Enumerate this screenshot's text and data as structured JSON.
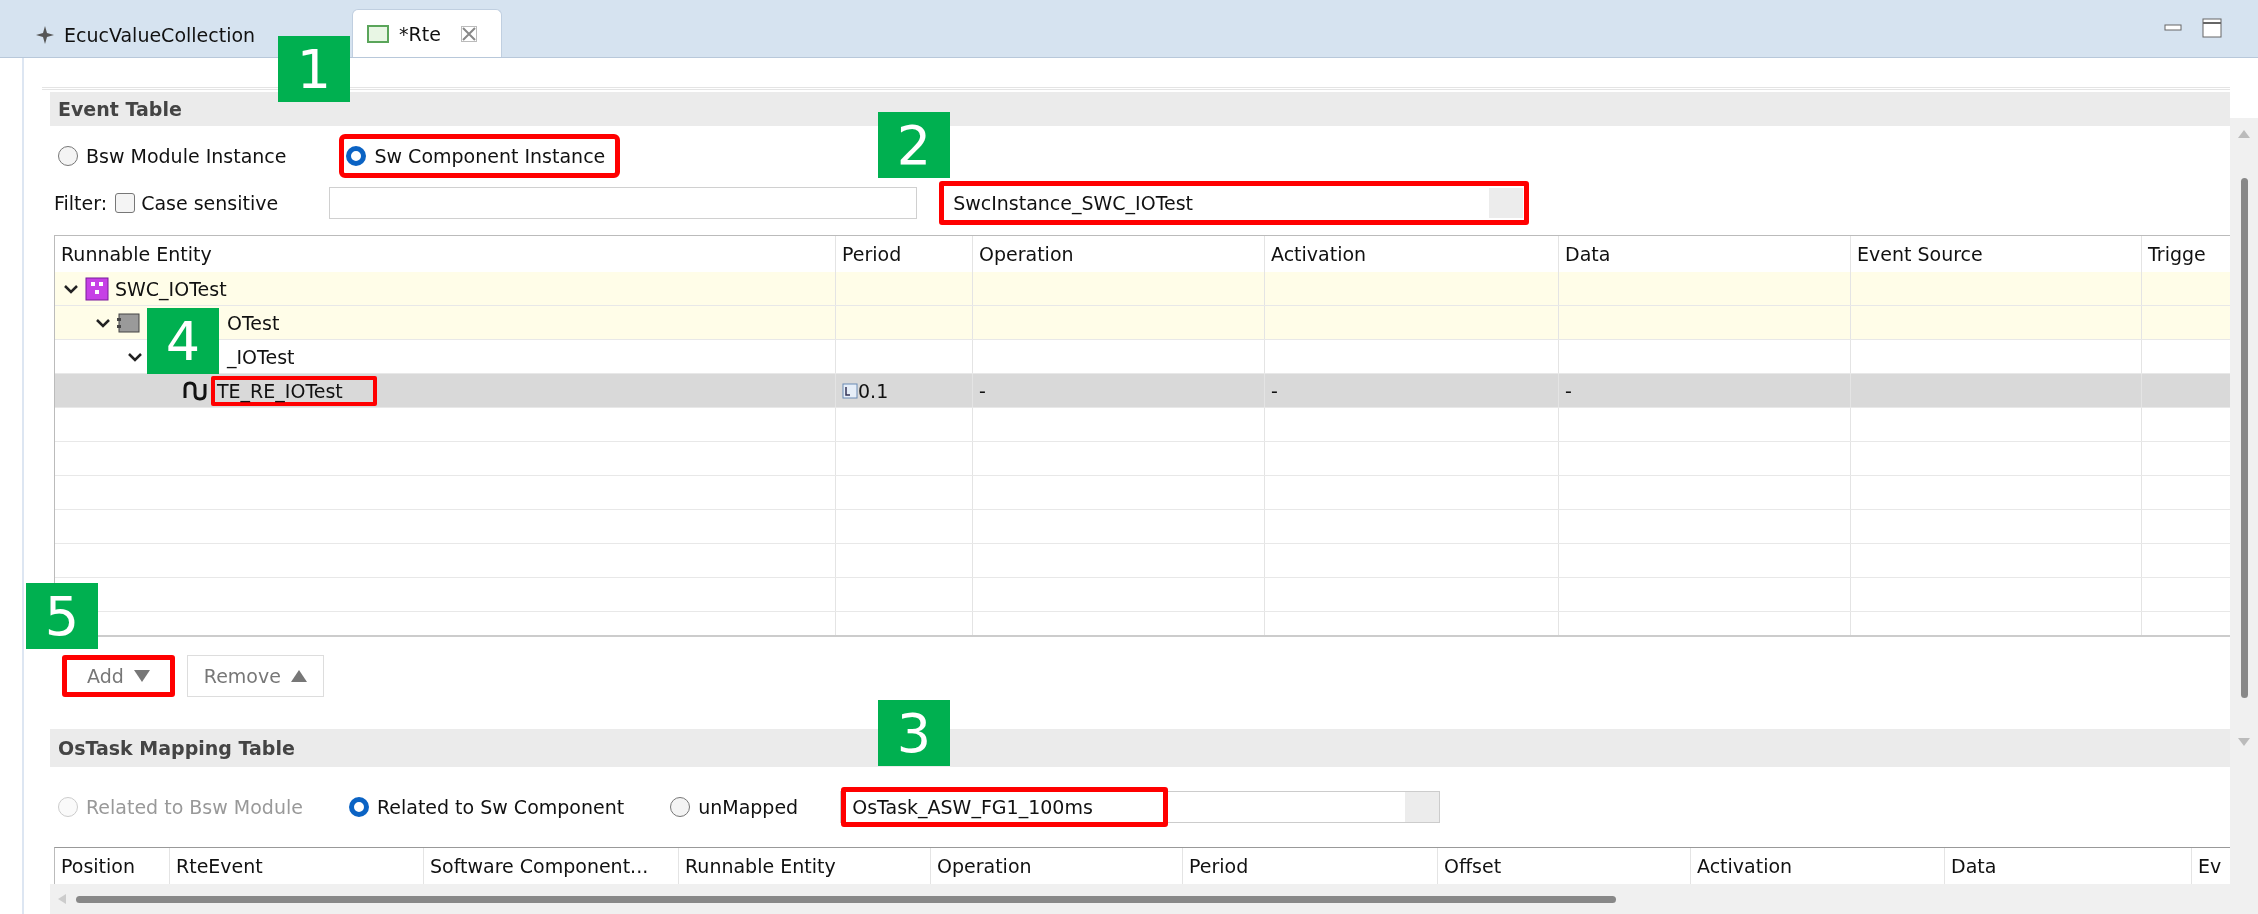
{
  "tabs": [
    {
      "label": "EcucValueCollection",
      "selected": false
    },
    {
      "label": "*Rte",
      "selected": true
    }
  ],
  "event_table": {
    "title": "Event Table",
    "modes": [
      {
        "label": "Bsw Module Instance",
        "selected": false,
        "disabled": false,
        "highlighted": false
      },
      {
        "label": "Sw Component Instance",
        "selected": true,
        "disabled": false,
        "highlighted": true
      }
    ],
    "filter": {
      "label": "Filter:",
      "case_sensitive": {
        "label": "Case sensitive",
        "checked": false
      }
    },
    "instance": {
      "value": "SwcInstance_SWC_IOTest",
      "highlighted": true
    },
    "columns": [
      "Runnable Entity",
      "Period",
      "Operation",
      "Activation",
      "Data",
      "Event Source",
      "Trigge"
    ],
    "rows": [
      {
        "kind": "swc",
        "label": "SWC_IOTest",
        "expanded": true,
        "selected": false,
        "highlighted": false,
        "children": [
          {
            "kind": "prototype",
            "label": "OTest",
            "expanded": true,
            "selected": false,
            "highlighted": false,
            "children": [
              {
                "kind": "behavior",
                "label": "_IOTest",
                "expanded": true,
                "selected": false,
                "highlighted": false,
                "children": [
                  {
                    "kind": "event",
                    "label": "TE_RE_IOTest",
                    "period": "0.1",
                    "operation": "-",
                    "activation": "-",
                    "data": "-",
                    "selected": true,
                    "highlighted": true
                  }
                ]
              }
            ]
          }
        ]
      }
    ]
  },
  "buttons": [
    {
      "label": "Add",
      "highlighted": true
    },
    {
      "label": "Remove",
      "highlighted": false
    }
  ],
  "mapping_table": {
    "title": "OsTask Mapping Table",
    "modes": [
      {
        "label": "Related to Bsw Module",
        "selected": false,
        "disabled": true,
        "highlighted": false
      },
      {
        "label": "Related to Sw Component",
        "selected": true,
        "disabled": false,
        "highlighted": false
      },
      {
        "label": "unMapped",
        "selected": false,
        "disabled": false,
        "highlighted": false
      }
    ],
    "task": {
      "value": "OsTask_ASW_FG1_100ms",
      "highlighted": true
    },
    "columns": [
      "Position",
      "RteEvent",
      "Software Component...",
      "Runnable Entity",
      "Operation",
      "Period",
      "Offset",
      "Activation",
      "Data",
      "Ev"
    ]
  },
  "callouts": [
    "1",
    "2",
    "3",
    "4",
    "5"
  ]
}
